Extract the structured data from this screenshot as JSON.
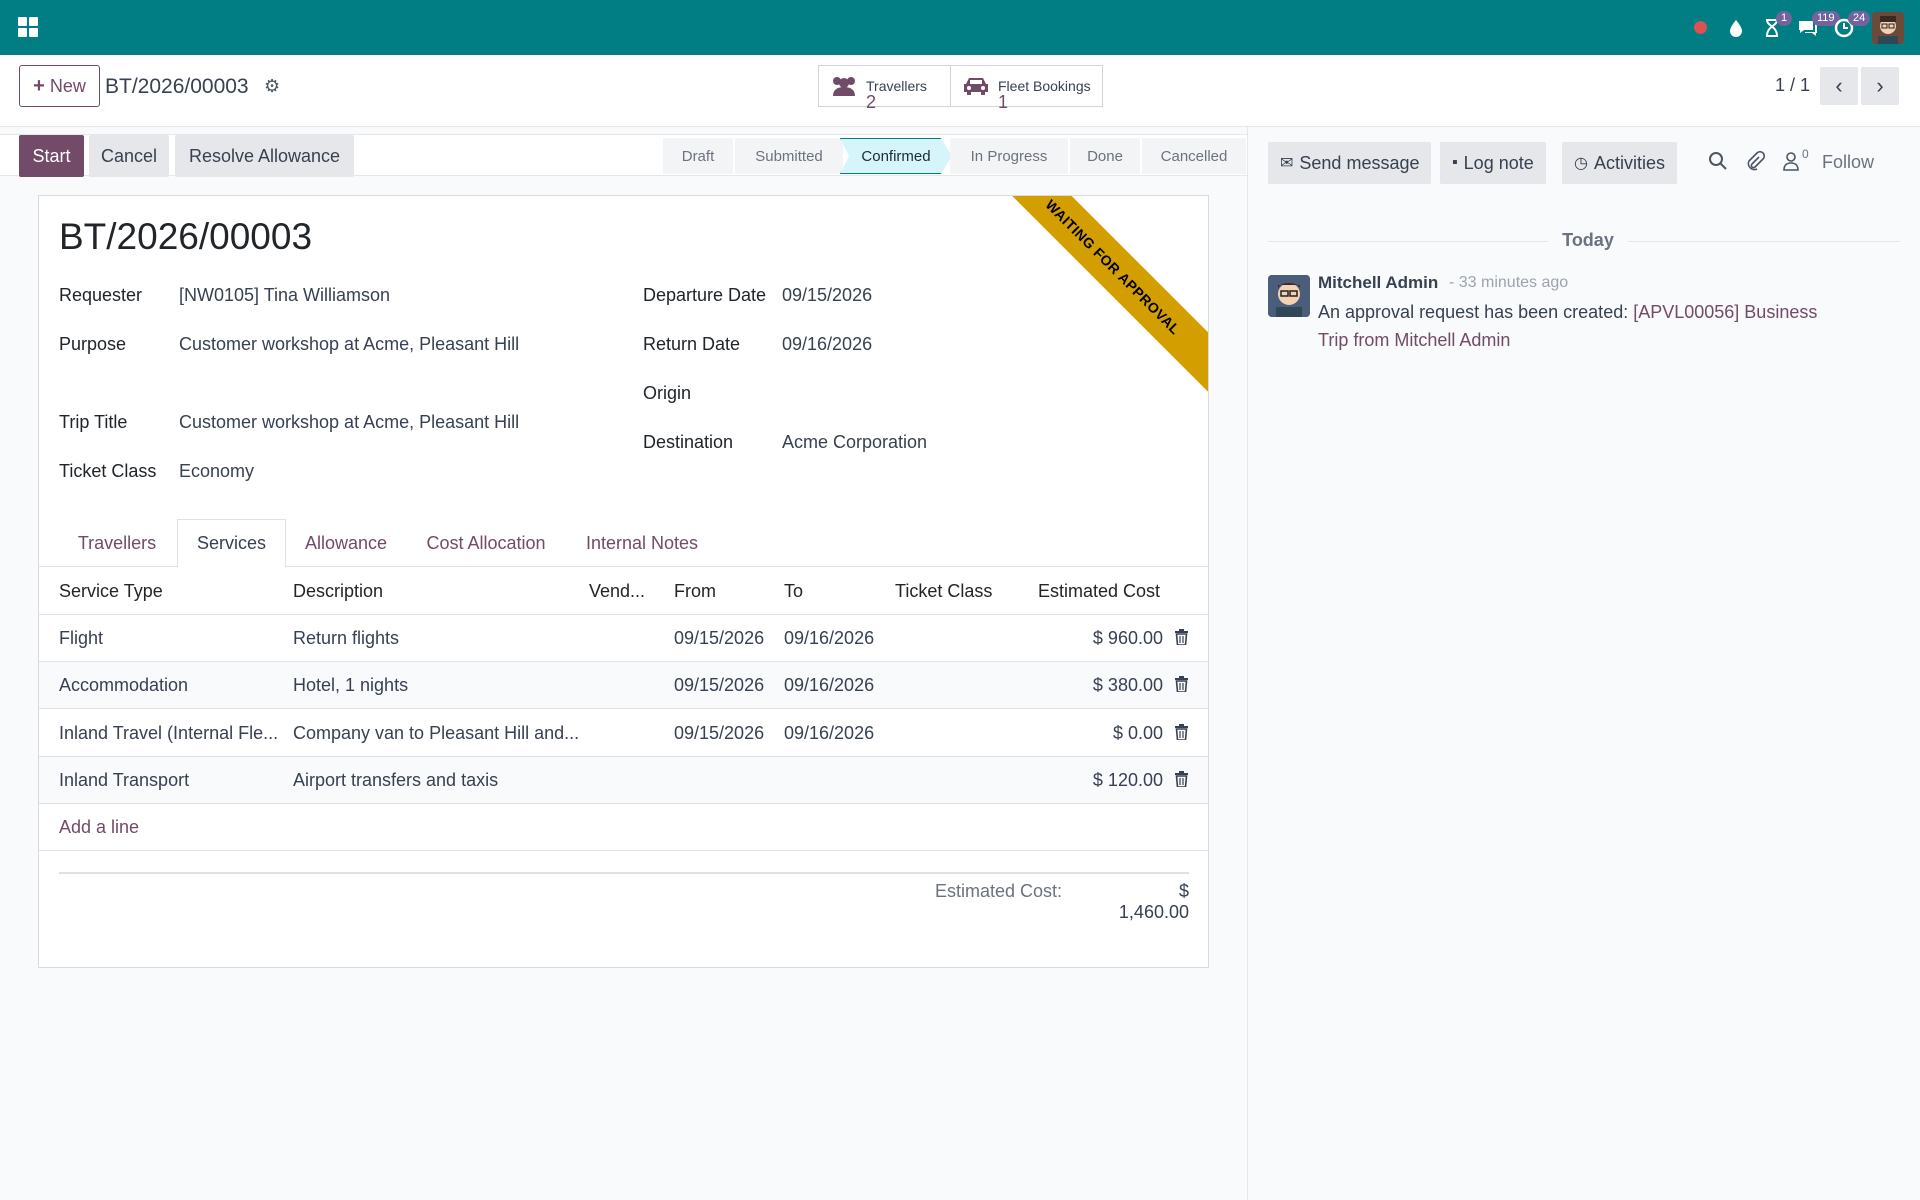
{
  "navbar": {
    "badges": {
      "activities_clock": "1",
      "messages": "119",
      "updates": "24"
    }
  },
  "control_panel": {
    "new_label": "New",
    "record_title": "BT/2026/00003",
    "smart_buttons": [
      {
        "label": "Travellers",
        "value": "2"
      },
      {
        "label": "Fleet Bookings",
        "value": "1"
      }
    ],
    "pager": "1 / 1"
  },
  "actions": {
    "start": "Start",
    "cancel": "Cancel",
    "resolve": "Resolve Allowance"
  },
  "stages": [
    "Draft",
    "Submitted",
    "Confirmed",
    "In Progress",
    "Done",
    "Cancelled"
  ],
  "active_stage": "Confirmed",
  "form": {
    "title": "BT/2026/00003",
    "ribbon": "WAITING FOR APPROVAL",
    "left": [
      {
        "label": "Requester",
        "value": "[NW0105] Tina Williamson"
      },
      {
        "label": "Purpose",
        "value": "Customer workshop at Acme, Pleasant Hill"
      },
      {
        "label": "Trip Title",
        "value": "Customer workshop at Acme, Pleasant Hill"
      },
      {
        "label": "Ticket Class",
        "value": "Economy"
      }
    ],
    "right": [
      {
        "label": "Departure Date",
        "value": "09/15/2026"
      },
      {
        "label": "Return Date",
        "value": "09/16/2026"
      },
      {
        "label": "Origin",
        "value": ""
      },
      {
        "label": "Destination",
        "value": "Acme Corporation"
      }
    ],
    "tabs": [
      "Travellers",
      "Services",
      "Allowance",
      "Cost Allocation",
      "Internal Notes"
    ],
    "active_tab": "Services",
    "table": {
      "columns": [
        "Service Type",
        "Description",
        "Vend...",
        "From",
        "To",
        "Ticket Class",
        "Estimated Cost"
      ],
      "rows": [
        {
          "type": "Flight",
          "desc": "Return flights",
          "vendor": "",
          "from": "09/15/2026",
          "to": "09/16/2026",
          "class": "",
          "cost": "$ 960.00"
        },
        {
          "type": "Accommodation",
          "desc": "Hotel, 1 nights",
          "vendor": "",
          "from": "09/15/2026",
          "to": "09/16/2026",
          "class": "",
          "cost": "$ 380.00"
        },
        {
          "type": "Inland Travel (Internal Fle...",
          "desc": "Company van to Pleasant Hill and...",
          "vendor": "",
          "from": "09/15/2026",
          "to": "09/16/2026",
          "class": "",
          "cost": "$ 0.00"
        },
        {
          "type": "Inland Transport",
          "desc": "Airport transfers and taxis",
          "vendor": "",
          "from": "",
          "to": "",
          "class": "",
          "cost": "$ 120.00"
        }
      ],
      "add_line": "Add a line"
    },
    "total_label": "Estimated Cost:",
    "total_value": "$ 1,460.00"
  },
  "chatter": {
    "send_message": "Send message",
    "log_note": "Log note",
    "activities": "Activities",
    "followers_count": "0",
    "follow": "Follow",
    "date_separator": "Today",
    "message": {
      "author": "Mitchell Admin",
      "when": "- 33 minutes ago",
      "text": "An approval request has been created: ",
      "link": "[APVL00056] Business Trip from Mitchell Admin"
    }
  },
  "colors": {
    "navbar": "#017e84",
    "primary": "#714b67",
    "ribbon": "#d39e00",
    "active_stage": "#d5f5fa"
  }
}
